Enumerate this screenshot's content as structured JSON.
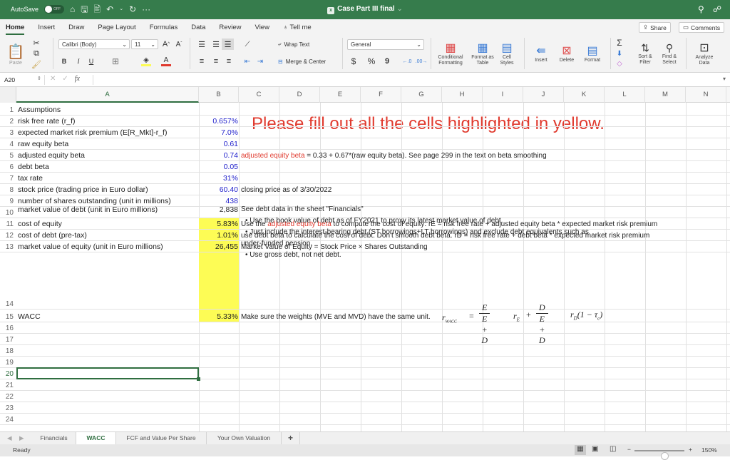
{
  "titlebar": {
    "autosave_label": "AutoSave",
    "autosave_state": "OFF",
    "doc_title": "Case Part III final",
    "quick_access": [
      "home-icon",
      "save-icon",
      "save-as-icon",
      "undo-icon",
      "redo-icon",
      "more-icon"
    ],
    "more": "···"
  },
  "ribbon_tabs": [
    "Home",
    "Insert",
    "Draw",
    "Page Layout",
    "Formulas",
    "Data",
    "Review",
    "View",
    "Tell me"
  ],
  "active_tab": "Home",
  "share_label": "Share",
  "comments_label": "Comments",
  "ribbon": {
    "paste": "Paste",
    "font_name": "Calibri (Body)",
    "font_size": "11",
    "bold": "B",
    "italic": "I",
    "underline": "U",
    "wrap_text": "Wrap Text",
    "merge_center": "Merge & Center",
    "number_format": "General",
    "currency": "$",
    "percent": "%",
    "comma": "9",
    "conditional_formatting": "Conditional Formatting",
    "format_as_table": "Format as Table",
    "cell_styles": "Cell Styles",
    "insert": "Insert",
    "delete": "Delete",
    "format": "Format",
    "sort_filter": "Sort & Filter",
    "find_select": "Find & Select",
    "analyze_data": "Analyze Data",
    "font_color": "#e03a2e",
    "fill_color": "#fdfc55"
  },
  "formula_bar": {
    "name_box": "A20",
    "fx": "fx",
    "content": ""
  },
  "columns": [
    "A",
    "B",
    "C",
    "D",
    "E",
    "F",
    "G",
    "H",
    "I",
    "J",
    "K",
    "L",
    "M",
    "N"
  ],
  "selected_column": "A",
  "selected_row": "20",
  "instruction": "Please fill out all the cells highlighted in yellow.",
  "rows": [
    {
      "num": "1",
      "a": "Assumptions",
      "b": "",
      "c": ""
    },
    {
      "num": "2",
      "a": "risk free rate (r_f)",
      "b": "0.657%",
      "c": ""
    },
    {
      "num": "3",
      "a": "expected market risk premium (E[R_Mkt]-r_f)",
      "b": "7.0%",
      "c": ""
    },
    {
      "num": "4",
      "a": "raw equity beta",
      "b": "0.61",
      "c": ""
    },
    {
      "num": "5",
      "a": "adjusted equity beta",
      "b": "0.74",
      "c_red": "adjusted equity beta",
      "c": " = 0.33 + 0.67*(raw equity beta). See page 299 in the text on beta smoothing"
    },
    {
      "num": "6",
      "a": "debt beta",
      "b": "0.05",
      "c": ""
    },
    {
      "num": "7",
      "a": "tax rate",
      "b": "31%",
      "c": ""
    },
    {
      "num": "8",
      "a": "stock price (trading price in Euro dollar)",
      "b": "60.40",
      "c": "closing price as of 3/30/2022"
    },
    {
      "num": "9",
      "a": "number of shares outstanding (unit in millions)",
      "b": "438",
      "c": ""
    },
    {
      "num": "10",
      "a": "",
      "b": "",
      "c": ""
    },
    {
      "num": "11",
      "a": "cost of equity",
      "b": "5.83%",
      "c_pre": "Use the ",
      "c_red": "adjusted equity beta",
      "c": " to compute the cost of equity: rE = risk free rate + adjusted equity beta * expected market risk premium"
    },
    {
      "num": "12",
      "a": "cost of debt (pre-tax)",
      "b": "1.01%",
      "c": "use debt beta to calculate the cost of debt. Don't smooth debt beta. rD = risk free rate + debt beta * expected market risk premium"
    },
    {
      "num": "13",
      "a": "market value of equity  (unit in Euro millions)",
      "b": "26,455",
      "c": "Market Value of Equity = Stock Price × Shares Outstanding"
    },
    {
      "num": "14",
      "a": "market value of debt  (unit in Euro millions)",
      "b": "2,838",
      "c": "See debt data in the sheet \"Financials\"",
      "c_lines": [
        "• Use the book value of debt as of FY2021 to proxy its latest market value of debt.",
        "• Just include the interest-bearing debt (ST borrowings+LT borrowings) and exclude debt equivalents such as",
        "under-funded pension.",
        "• Use gross debt, not net debt."
      ]
    },
    {
      "num": "15",
      "a": "WACC",
      "b": "5.33%",
      "c": "Make sure the weights (MVE and MVD) have the same unit."
    },
    {
      "num": "16"
    },
    {
      "num": "17"
    },
    {
      "num": "18"
    },
    {
      "num": "19"
    },
    {
      "num": "20"
    },
    {
      "num": "21"
    },
    {
      "num": "22"
    },
    {
      "num": "23"
    },
    {
      "num": "24"
    }
  ],
  "wacc_formula": {
    "lhs": "r",
    "lhs_sub": "WACC",
    "eq": "=",
    "e_num": "E",
    "e_den": "E + D",
    "re": "r",
    "re_sub": "E",
    "plus": "+",
    "d_num": "D",
    "d_den": "E + D",
    "rd": "r",
    "rd_sub": "D",
    "tax_term": "(1 − τ",
    "tax_sub": "c",
    "close": ")"
  },
  "sheet_tabs": [
    "Financials",
    "WACC",
    "FCF and Value Per Share",
    "Your Own Valuation"
  ],
  "active_sheet": "WACC",
  "add_sheet": "+",
  "status": {
    "ready": "Ready",
    "zoom": "150%",
    "zoom_minus": "−",
    "zoom_plus": "+",
    "zoom_level_fraction": 0.6
  }
}
